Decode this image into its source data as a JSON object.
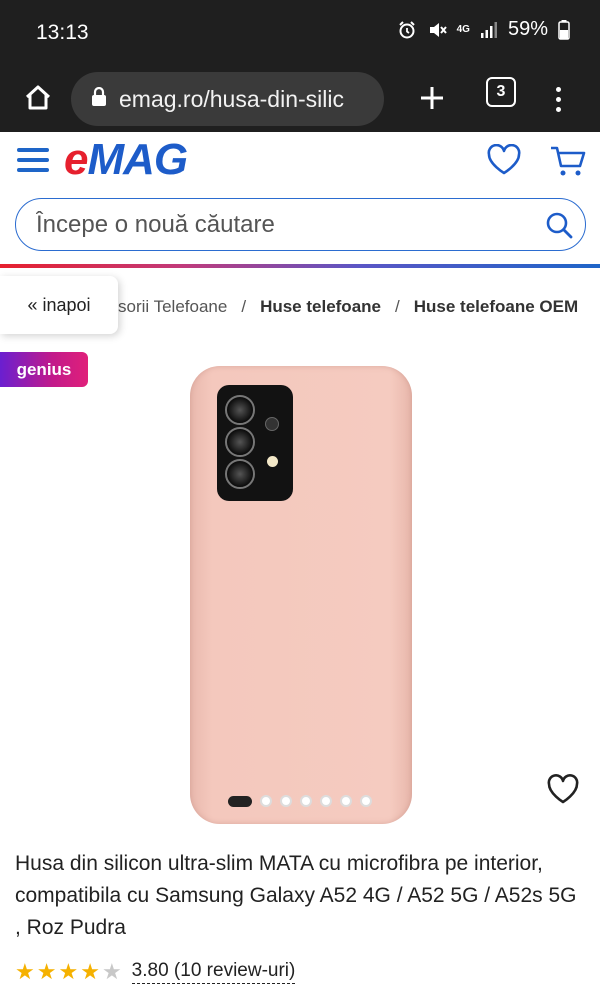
{
  "status_bar": {
    "time": "13:13",
    "network": "4G",
    "battery": "59%"
  },
  "browser": {
    "url": "emag.ro/husa-din-silic",
    "tab_count": "3"
  },
  "site": {
    "logo_e": "e",
    "logo_rest": "MAG",
    "search_placeholder": "Începe o nouă căutare"
  },
  "breadcrumb": {
    "back_label": "« inapoi",
    "items": [
      "Accesorii Telefoane",
      "Huse telefoane",
      "Huse telefoane OEM"
    ],
    "visible_first": "sorii Telefoane",
    "separator": "/"
  },
  "badge": {
    "label": "genius"
  },
  "product": {
    "title": "Husa din silicon ultra-slim MATA cu microfibra pe interior, compatibila cu Samsung Galaxy A52 4G / A52 5G / A52s 5G , Roz Pudra",
    "rating_value": 3.8,
    "rating_text": "3.80 (10 review-uri)",
    "stars_full": 4,
    "stars_total": 5,
    "image_count": 7,
    "current_image": 1,
    "case_color": "#f4c8bd"
  },
  "colors": {
    "brand_blue": "#1d5cc9",
    "brand_red": "#e6202e",
    "star": "#f5b100"
  }
}
